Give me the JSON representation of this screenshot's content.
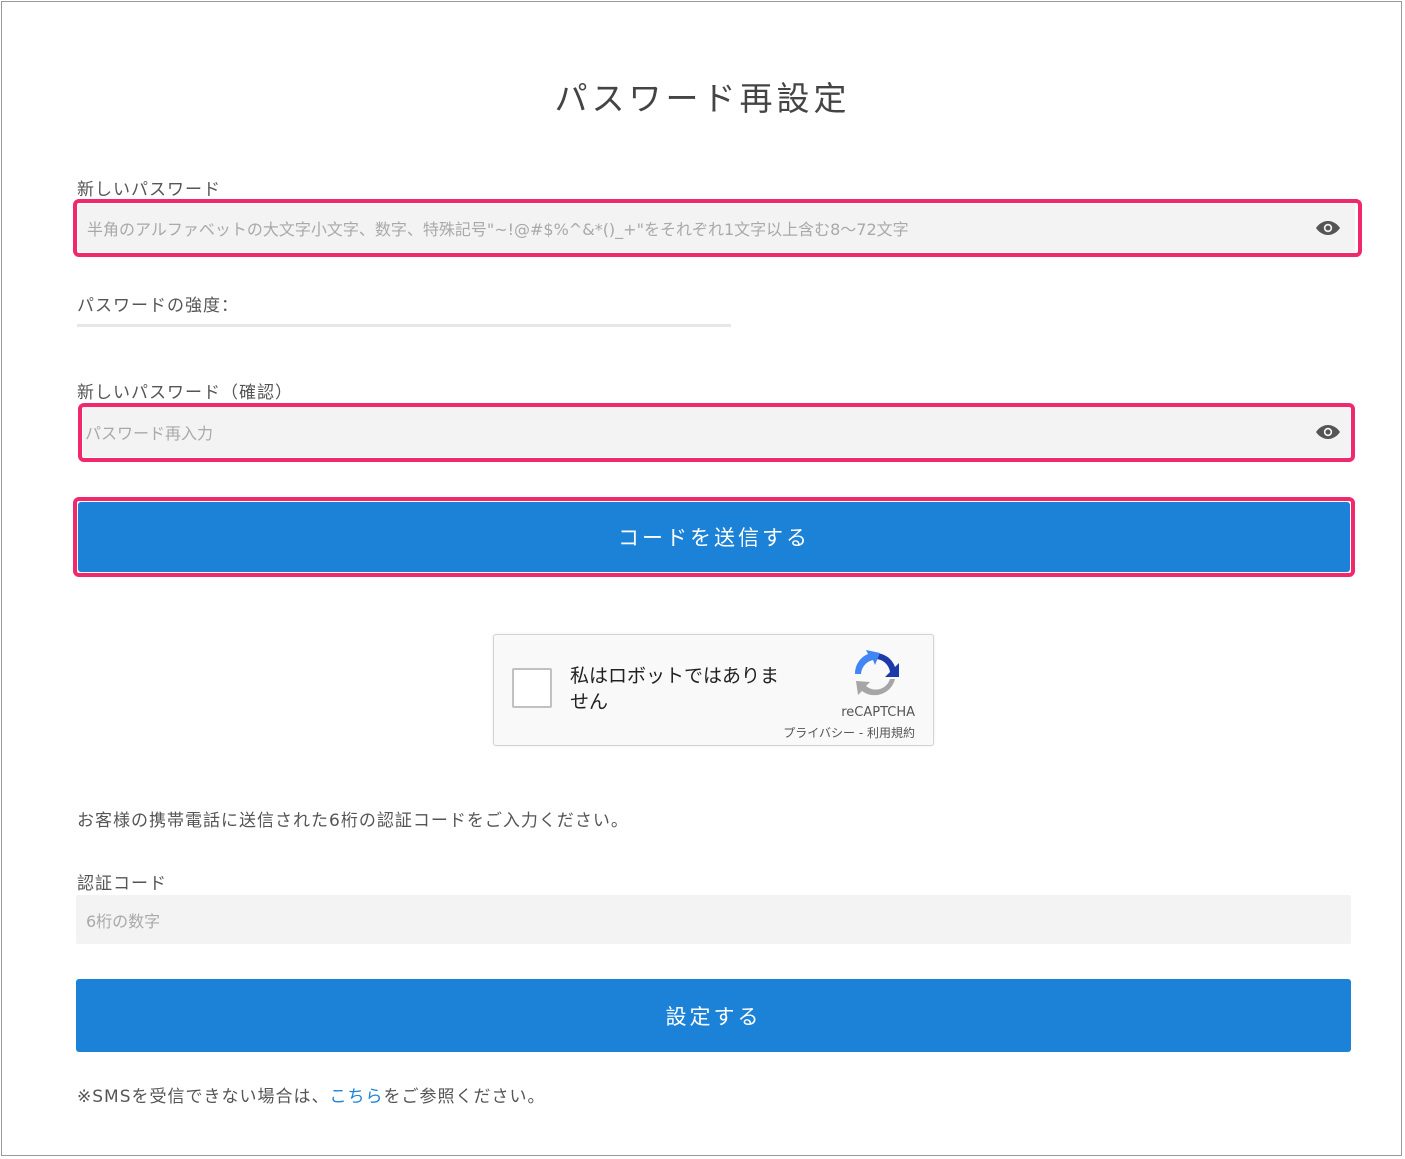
{
  "page": {
    "title": "パスワード再設定"
  },
  "new_password": {
    "label": "新しいパスワード",
    "placeholder": "半角のアルファベットの大文字小文字、数字、特殊記号\"~!@#$%^&*()_+\"をそれぞれ1文字以上含む8～72文字",
    "toggle_icon": "eye-icon"
  },
  "strength": {
    "label": "パスワードの強度："
  },
  "confirm_password": {
    "label": "新しいパスワード（確認）",
    "placeholder": "パスワード再入力",
    "toggle_icon": "eye-icon"
  },
  "send_code_button": {
    "label": "コードを送信する"
  },
  "recaptcha": {
    "checkbox_label": "私はロボットではありません",
    "brand": "reCAPTCHA",
    "links": "プライバシー - 利用規約",
    "icon": "recaptcha-logo-icon"
  },
  "instruction": {
    "text": "お客様の携帯電話に送信された6桁の認証コードをご入力ください。"
  },
  "verification_code": {
    "label": "認証コード",
    "placeholder": "6桁の数字"
  },
  "submit_button": {
    "label": "設定する"
  },
  "footer_note": {
    "prefix": "※SMSを受信できない場合は、",
    "link": "こちら",
    "suffix": "をご参照ください。"
  },
  "colors": {
    "primary": "#1b82d8",
    "highlight": "#f0296e",
    "field_bg": "#f3f3f3"
  }
}
